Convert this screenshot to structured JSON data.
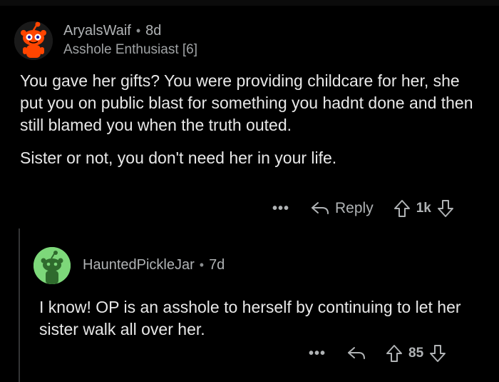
{
  "comment1": {
    "author": "AryalsWaif",
    "age": "8d",
    "flair": "Asshole Enthusiast [6]",
    "paragraphs": [
      "You gave her gifts?  You were providing childcare for her, she put you on public blast for something you hadnt done and then still blamed you when the truth outed.",
      "Sister or not, you don't need her in your life."
    ],
    "actions": {
      "more": "•••",
      "reply_label": "Reply",
      "vote_count": "1k"
    }
  },
  "comment2": {
    "author": "HauntedPickleJar",
    "age": "7d",
    "text": "I know! OP is an asshole to herself by continuing to let her sister walk all over her.",
    "actions": {
      "more": "•••",
      "vote_count": "85"
    }
  },
  "separator": "•",
  "colors": {
    "background": "#000000",
    "text": "#e8e8e8",
    "meta": "#b0b3b5",
    "avatar1_bg": "#ff4500",
    "avatar2_bg": "#7dd87a"
  },
  "icons": [
    "snoo-avatar-icon",
    "reply-arrow-icon",
    "upvote-arrow-icon",
    "downvote-arrow-icon",
    "more-options-icon"
  ]
}
